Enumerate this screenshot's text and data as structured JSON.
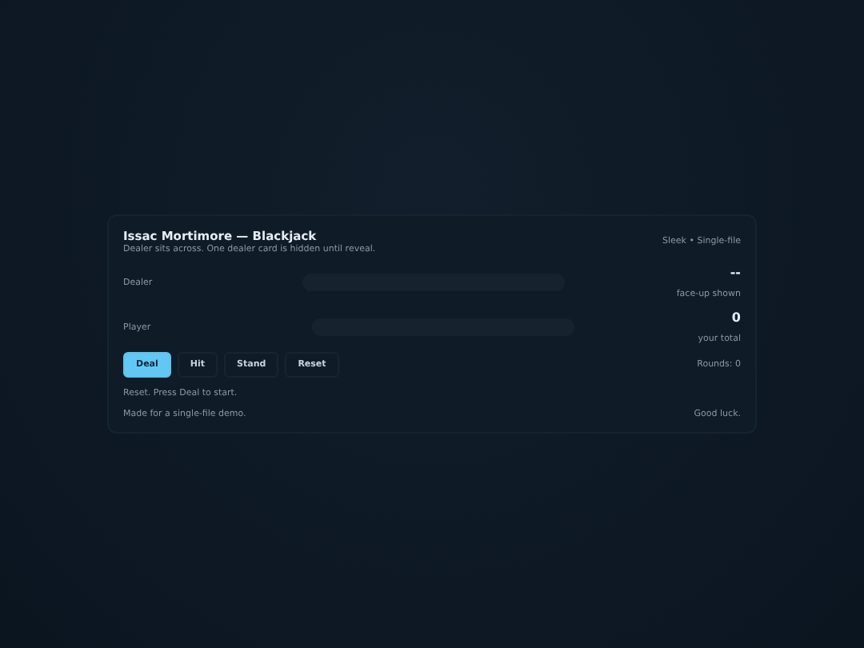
{
  "header": {
    "title": "Issac Mortimore — Blackjack",
    "subtitle": "Dealer sits across. One dealer card is hidden until reveal.",
    "badge": "Sleek • Single-file"
  },
  "hands": [
    {
      "label": "Dealer",
      "score": "--",
      "caption": "face-up shown"
    },
    {
      "label": "Player",
      "score": "0",
      "caption": "your total"
    }
  ],
  "buttons": [
    {
      "label": "Deal",
      "kind": "primary"
    },
    {
      "label": "Hit",
      "kind": "default"
    },
    {
      "label": "Stand",
      "kind": "default"
    },
    {
      "label": "Reset",
      "kind": "default"
    }
  ],
  "rounds": "Rounds: 0",
  "status": "Reset. Press Deal to start.",
  "footer": {
    "left": "Made for a single-file demo.",
    "right": "Good luck."
  }
}
